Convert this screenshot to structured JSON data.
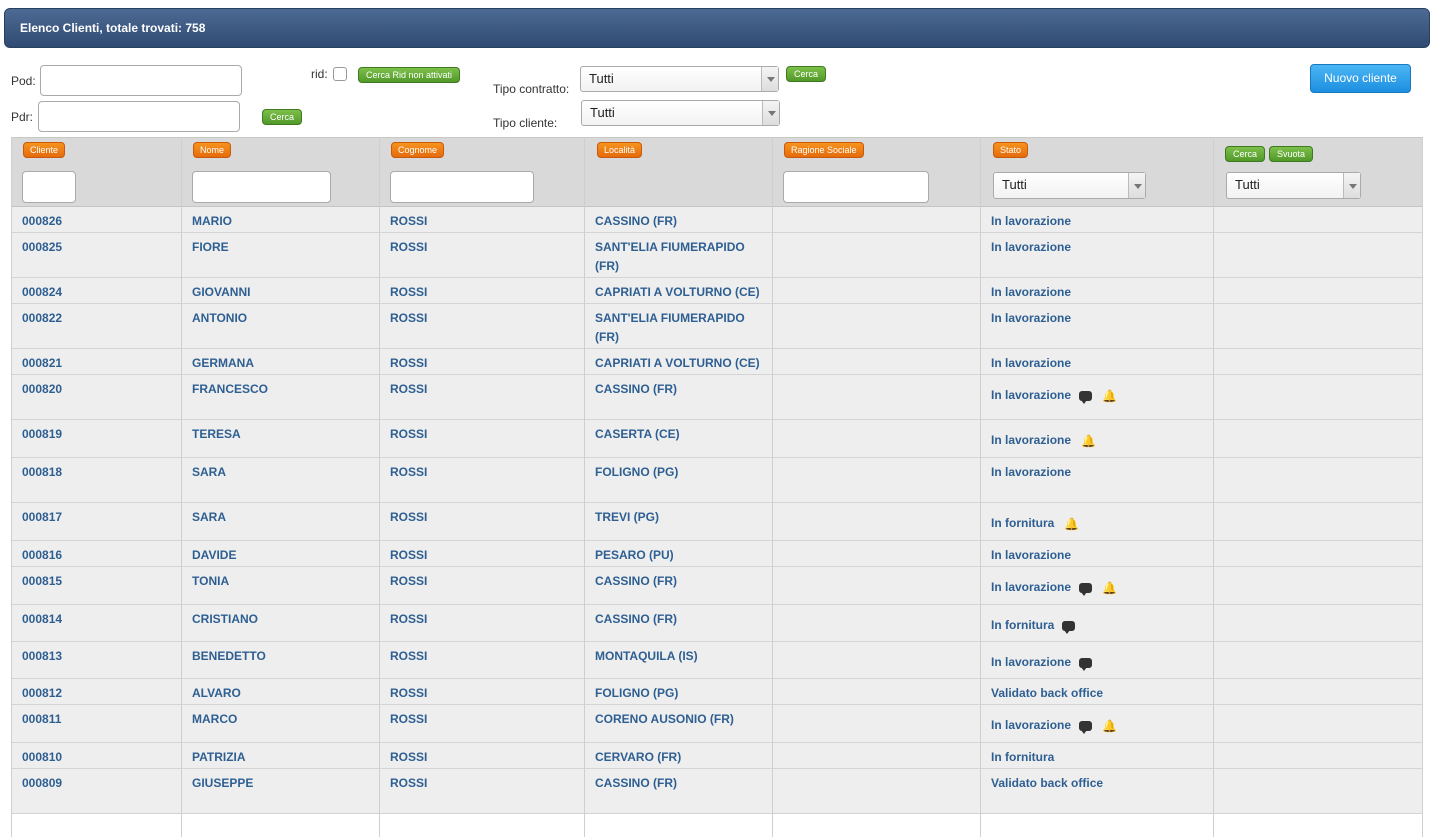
{
  "title": "Elenco Clienti, totale trovati: 758",
  "filters": {
    "pod_label": "Pod:",
    "pdr_label": "Pdr:",
    "rid_label": "rid:",
    "cerca_rid_label": "Cerca Rid non attivati",
    "cerca_pdr_label": "Cerca",
    "tipo_contratto_label": "Tipo contratto:",
    "tipo_contratto_value": "Tutti",
    "tipo_cliente_label": "Tipo cliente:",
    "tipo_cliente_value": "Tutti",
    "cerca_contratto_label": "Cerca",
    "nuovo_cliente_label": "Nuovo cliente"
  },
  "table": {
    "headers": {
      "cliente": "Cliente",
      "nome": "Nome",
      "cognome": "Cognome",
      "localita": "Località",
      "ragione_sociale": "Ragione Sociale",
      "stato": "Stato"
    },
    "stato_filter_value": "Tutti",
    "extra_filter_value": "Tutti",
    "cerca_label": "Cerca",
    "svuota_label": "Svuota",
    "rows": [
      {
        "cliente": "000826",
        "nome": "MARIO",
        "cognome": "ROSSI",
        "localita": "CASSINO (FR)",
        "stato": "In lavorazione",
        "comment": false,
        "bell": false
      },
      {
        "cliente": "000825",
        "nome": "FIORE",
        "cognome": "ROSSI",
        "localita": "SANT'ELIA FIUMERAPIDO (FR)",
        "stato": "In lavorazione",
        "comment": false,
        "bell": false
      },
      {
        "cliente": "000824",
        "nome": "GIOVANNI",
        "cognome": "ROSSI",
        "localita": "CAPRIATI A VOLTURNO (CE)",
        "stato": "In lavorazione",
        "comment": false,
        "bell": false
      },
      {
        "cliente": "000822",
        "nome": "ANTONIO",
        "cognome": "ROSSI",
        "localita": "SANT'ELIA FIUMERAPIDO (FR)",
        "stato": "In lavorazione",
        "comment": false,
        "bell": false
      },
      {
        "cliente": "000821",
        "nome": "GERMANA",
        "cognome": "ROSSI",
        "localita": "CAPRIATI A VOLTURNO (CE)",
        "stato": "In lavorazione",
        "comment": false,
        "bell": false
      },
      {
        "cliente": "000820",
        "nome": "FRANCESCO",
        "cognome": "ROSSI",
        "localita": "CASSINO (FR)",
        "stato": "In lavorazione",
        "comment": true,
        "bell": true
      },
      {
        "cliente": "000819",
        "nome": "TERESA",
        "cognome": "ROSSI",
        "localita": "CASERTA (CE)",
        "stato": "In lavorazione",
        "comment": false,
        "bell": true
      },
      {
        "cliente": "000818",
        "nome": "SARA",
        "cognome": "ROSSI",
        "localita": "FOLIGNO (PG)",
        "stato": "In lavorazione",
        "comment": false,
        "bell": false
      },
      {
        "cliente": "000817",
        "nome": "SARA",
        "cognome": "ROSSI",
        "localita": "TREVI (PG)",
        "stato": "In fornitura",
        "comment": false,
        "bell": true
      },
      {
        "cliente": "000816",
        "nome": "DAVIDE",
        "cognome": "ROSSI",
        "localita": "PESARO (PU)",
        "stato": "In lavorazione",
        "comment": false,
        "bell": false
      },
      {
        "cliente": "000815",
        "nome": "TONIA",
        "cognome": "ROSSI",
        "localita": "CASSINO (FR)",
        "stato": "In lavorazione",
        "comment": true,
        "bell": true
      },
      {
        "cliente": "000814",
        "nome": "CRISTIANO",
        "cognome": "ROSSI",
        "localita": "CASSINO (FR)",
        "stato": "In fornitura",
        "comment": true,
        "bell": false
      },
      {
        "cliente": "000813",
        "nome": "BENEDETTO",
        "cognome": "ROSSI",
        "localita": "MONTAQUILA (IS)",
        "stato": "In lavorazione",
        "comment": true,
        "bell": false
      },
      {
        "cliente": "000812",
        "nome": "ALVARO",
        "cognome": "ROSSI",
        "localita": "FOLIGNO (PG)",
        "stato": "Validato back office",
        "comment": false,
        "bell": false
      },
      {
        "cliente": "000811",
        "nome": "MARCO",
        "cognome": "ROSSI",
        "localita": "CORENO AUSONIO (FR)",
        "stato": "In lavorazione",
        "comment": true,
        "bell": true
      },
      {
        "cliente": "000810",
        "nome": "PATRIZIA",
        "cognome": "ROSSI",
        "localita": "CERVARO (FR)",
        "stato": "In fornitura",
        "comment": false,
        "bell": false
      },
      {
        "cliente": "000809",
        "nome": "GIUSEPPE",
        "cognome": "ROSSI",
        "localita": "CASSINO (FR)",
        "stato": "Validato back office",
        "comment": false,
        "bell": false
      }
    ]
  }
}
